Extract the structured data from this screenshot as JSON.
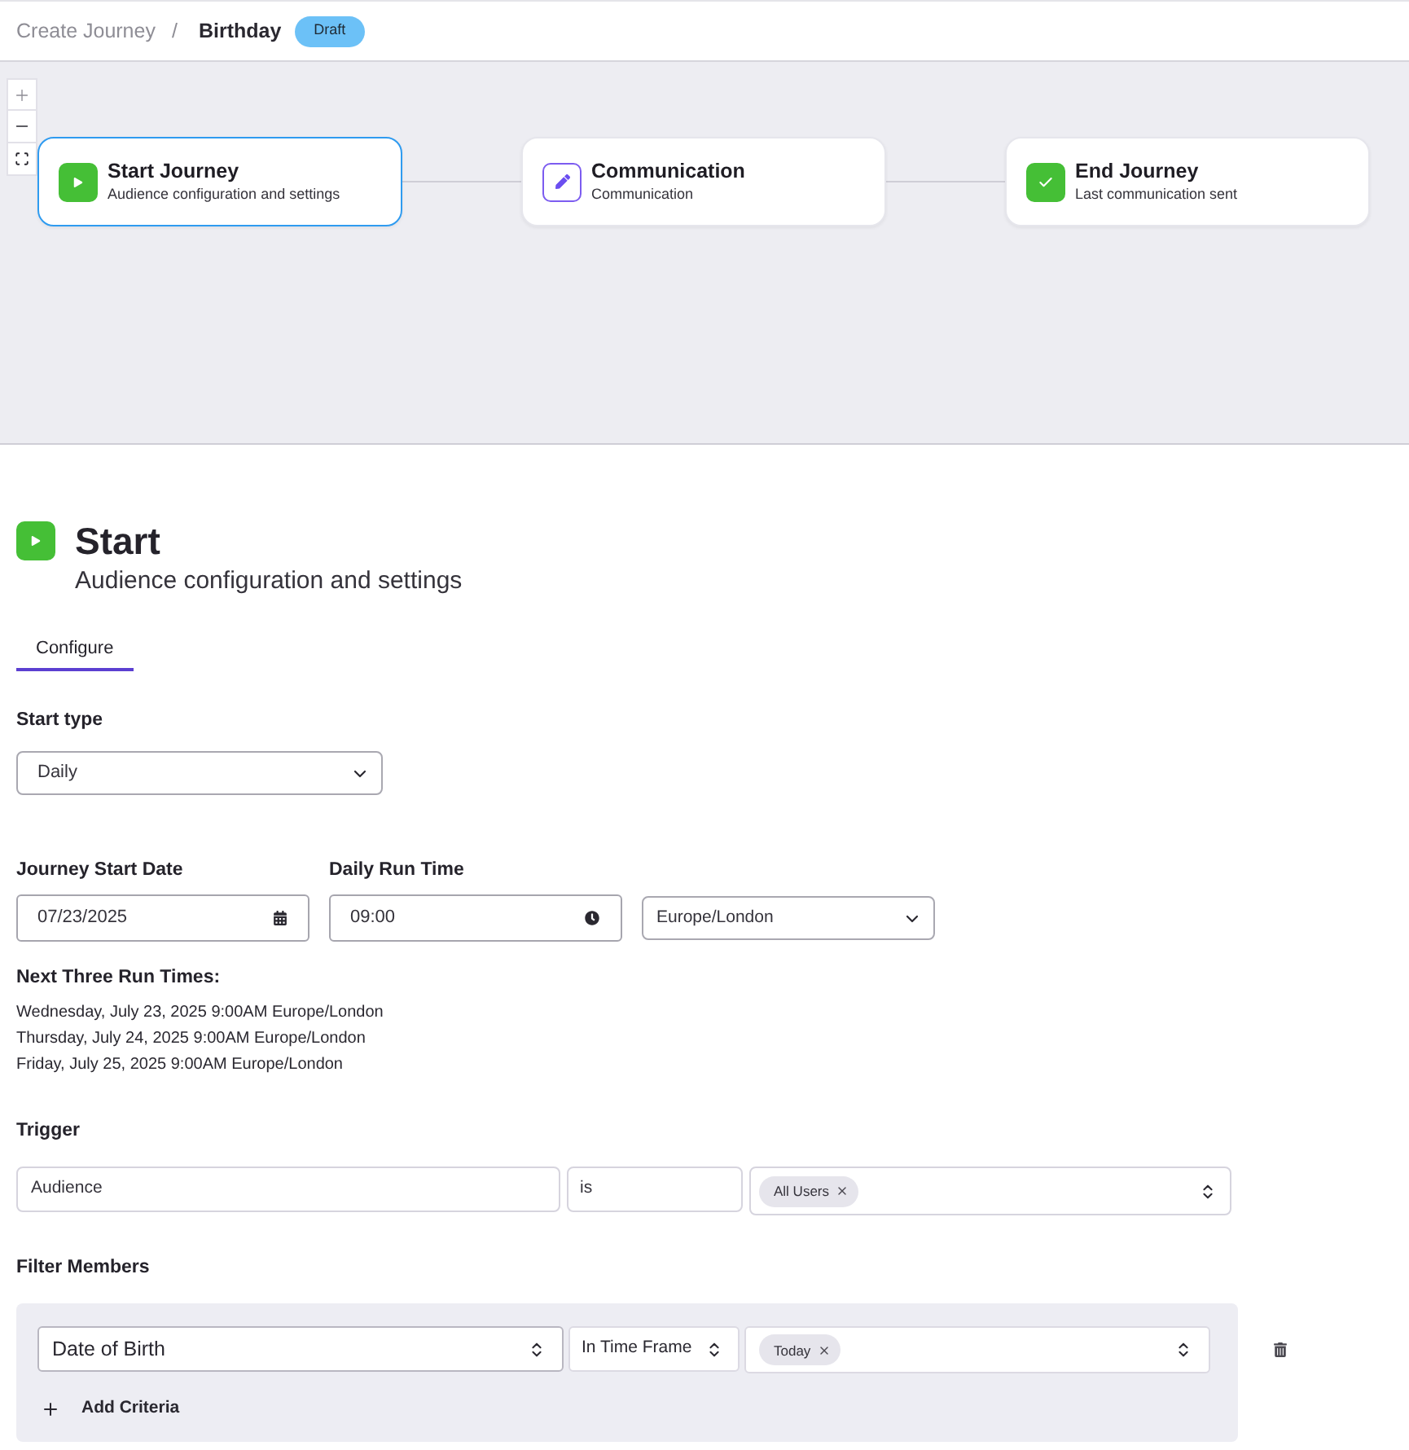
{
  "breadcrumb": {
    "parent": "Create Journey",
    "separator": "/",
    "current": "Birthday",
    "badge": "Draft"
  },
  "nodes": [
    {
      "kind": "start",
      "title": "Start Journey",
      "subtitle": "Audience configuration and settings",
      "selected": true
    },
    {
      "kind": "communication",
      "title": "Communication",
      "subtitle": "Communication",
      "selected": false
    },
    {
      "kind": "end",
      "title": "End Journey",
      "subtitle": "Last communication sent",
      "selected": false
    }
  ],
  "panel": {
    "kind": "start",
    "title": "Start",
    "subtitle": "Audience configuration and settings"
  },
  "tabs": [
    {
      "label": "Configure",
      "selected": true
    }
  ],
  "start_type": {
    "label": "Start type",
    "value": "Daily"
  },
  "schedule": {
    "date": {
      "label": "Journey Start Date",
      "value": "07/23/2025"
    },
    "time": {
      "label": "Daily Run Time",
      "value": "09:00"
    },
    "timezone": {
      "value": "Europe/London"
    }
  },
  "next_runs": {
    "label": "Next Three Run Times:",
    "items": [
      "Wednesday, July 23, 2025 9:00AM Europe/London",
      "Thursday, July 24, 2025 9:00AM Europe/London",
      "Friday, July 25, 2025 9:00AM Europe/London"
    ]
  },
  "trigger": {
    "label": "Trigger",
    "field": "Audience",
    "operator": "is",
    "values": [
      "All Users"
    ]
  },
  "filter": {
    "label": "Filter Members",
    "criteria": [
      {
        "field": "Date of Birth",
        "operator": "In Time Frame",
        "values": [
          "Today"
        ]
      }
    ],
    "add_button": "Add Criteria"
  }
}
